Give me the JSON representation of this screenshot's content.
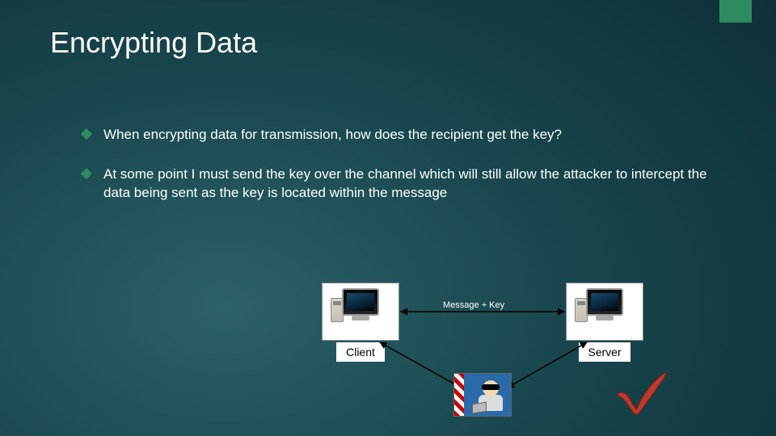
{
  "title": "Encrypting Data",
  "bullets": [
    "When encrypting data for transmission, how does the recipient get the key?",
    "At some point I must send the key over the channel which will still allow the attacker to intercept the data being sent as the key is located within the message"
  ],
  "diagram": {
    "client_label": "Client",
    "server_label": "Server",
    "edge_label": "Message + Key"
  },
  "colors": {
    "accent": "#2e8a60",
    "check": "#c0392b"
  }
}
